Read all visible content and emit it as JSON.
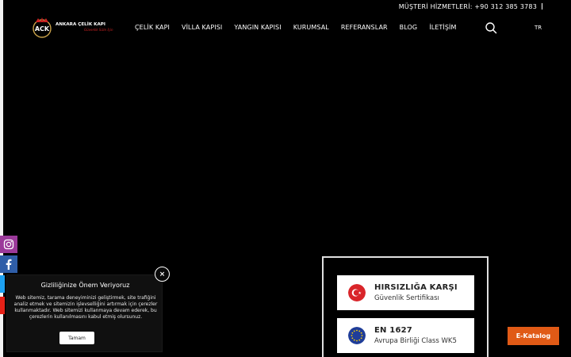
{
  "topbar": {
    "customer_service": "MÜŞTERİ HİZMETLERİ: +90 312 385 3783"
  },
  "brand": {
    "badge": "ACK",
    "name": "ANKARA ÇELİK KAPI",
    "tagline": "Güvenlik Sizin İçin"
  },
  "nav": {
    "items": [
      {
        "label": "ÇELİK KAPI"
      },
      {
        "label": "VİLLA KAPISI"
      },
      {
        "label": "YANGIN KAPISI"
      },
      {
        "label": "KURUMSAL"
      },
      {
        "label": "REFERANSLAR"
      },
      {
        "label": "BLOG"
      },
      {
        "label": "İLETİŞİM"
      }
    ],
    "language": "TR"
  },
  "icons": {
    "search": "search-icon",
    "instagram": "instagram-icon",
    "facebook": "facebook-icon",
    "twitter": "twitter-icon",
    "youtube": "youtube-icon",
    "close": "close-icon",
    "turkey_flag": "turkey-flag-icon",
    "eu_flag": "eu-flag-icon"
  },
  "cookie": {
    "title": "Gizliliğinize Önem Veriyoruz",
    "text": "Web sitemiz, tarama deneyiminizi geliştirmek, site trafiğini analiz etmek ve sitemizin işlevselliğini artırmak için çerezler kullanmaktadır. Web sitemizi kullanmaya devam ederek, bu çerezlerin kullanılmasını kabul etmiş olursunuz.",
    "accept_label": "Tamam",
    "close_label": "×"
  },
  "certificates": [
    {
      "title": "HIRSIZLIĞA KARŞI",
      "subtitle": "Güvenlik Sertifikası"
    },
    {
      "title": "EN 1627",
      "subtitle": "Avrupa Birliği Class WK5"
    }
  ],
  "ekatalog": {
    "label": "E-Katalog"
  },
  "colors": {
    "background": "#000000",
    "accent": "#e05a16",
    "instagram": "#9b3a9a",
    "facebook": "#2f5ea8"
  }
}
